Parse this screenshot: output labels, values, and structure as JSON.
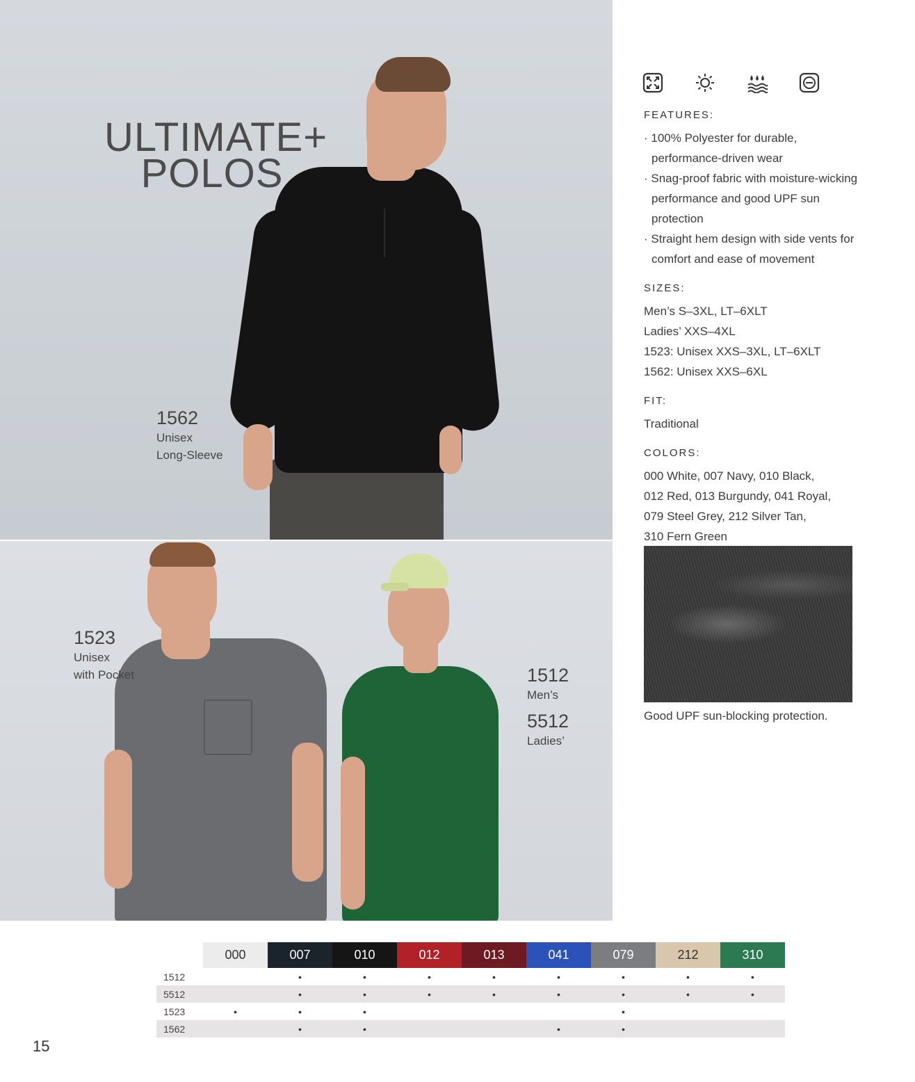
{
  "hero": {
    "line1": "ULTIMATE+",
    "line2": "POLOS"
  },
  "products": {
    "p1562": {
      "code": "1562",
      "line1": "Unisex",
      "line2": "Long-Sleeve"
    },
    "p1523": {
      "code": "1523",
      "line1": "Unisex",
      "line2": "with Pocket"
    },
    "p1512": {
      "code": "1512",
      "line1": "Men’s"
    },
    "p5512": {
      "code": "5512",
      "line1": "Ladies’"
    }
  },
  "icons": [
    "stretch-icon",
    "sun-protection-icon",
    "moisture-wicking-icon",
    "snag-resistant-icon"
  ],
  "features": {
    "heading": "FEATURES:",
    "items": [
      "· 100% Polyester for durable, performance-driven wear",
      "· Snag-proof fabric with moisture-wicking performance and good UPF sun protection",
      "· Straight hem design with side vents for comfort and ease of movement"
    ]
  },
  "sizes": {
    "heading": "SIZES:",
    "lines": [
      "Men’s S–3XL, LT–6XLT",
      "Ladies’ XXS–4XL",
      "1523: Unisex XXS–3XL, LT–6XLT",
      "1562: Unisex XXS–6XL"
    ]
  },
  "fit": {
    "heading": "FIT:",
    "value": "Traditional"
  },
  "colors": {
    "heading": "COLORS:",
    "lines": [
      "000 White, 007 Navy, 010 Black,",
      "012 Red, 013 Burgundy, 041 Royal,",
      "079 Steel Grey, 212 Silver Tan,",
      "310 Fern Green"
    ]
  },
  "fabric_caption": "Good UPF sun-blocking protection.",
  "color_table": {
    "columns": [
      {
        "code": "000",
        "bg": "#ececec",
        "fg": "#333333"
      },
      {
        "code": "007",
        "bg": "#1b232b",
        "fg": "#ffffff"
      },
      {
        "code": "010",
        "bg": "#151515",
        "fg": "#ffffff"
      },
      {
        "code": "012",
        "bg": "#b12126",
        "fg": "#ffffff"
      },
      {
        "code": "013",
        "bg": "#6e1a22",
        "fg": "#ffffff"
      },
      {
        "code": "041",
        "bg": "#2b52b8",
        "fg": "#ffffff"
      },
      {
        "code": "079",
        "bg": "#7c7d80",
        "fg": "#ffffff"
      },
      {
        "code": "212",
        "bg": "#d8c7ad",
        "fg": "#333333"
      },
      {
        "code": "310",
        "bg": "#2c7a52",
        "fg": "#ffffff"
      }
    ],
    "rows": [
      {
        "label": "1512",
        "marks": [
          "",
          "•",
          "•",
          "•",
          "•",
          "•",
          "•",
          "•",
          "•"
        ]
      },
      {
        "label": "5512",
        "marks": [
          "",
          "•",
          "•",
          "•",
          "•",
          "•",
          "•",
          "•",
          "•"
        ]
      },
      {
        "label": "1523",
        "marks": [
          "•",
          "•",
          "•",
          "",
          "",
          "",
          "•",
          "",
          ""
        ]
      },
      {
        "label": "1562",
        "marks": [
          "",
          "•",
          "•",
          "",
          "",
          "•",
          "•",
          "",
          ""
        ]
      }
    ]
  },
  "page_number": "15"
}
